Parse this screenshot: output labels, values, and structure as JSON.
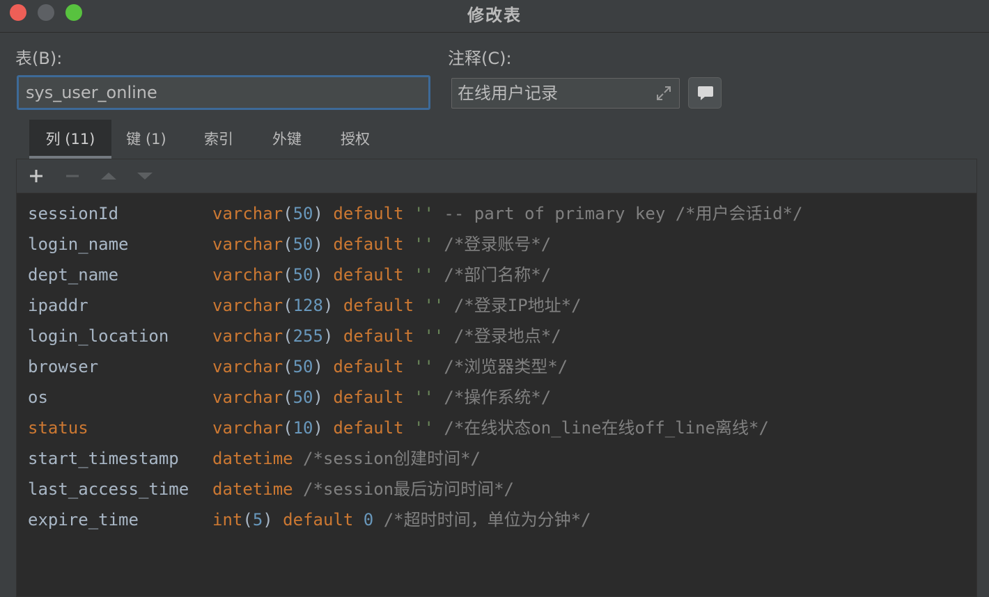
{
  "window": {
    "title": "修改表",
    "buttons": [
      "close",
      "minimize",
      "maximize"
    ]
  },
  "form": {
    "table_label": "表(B):",
    "table_value": "sys_user_online",
    "comment_label": "注释(C):",
    "comment_value": "在线用户记录"
  },
  "tabs": [
    {
      "label": "列 (11)",
      "active": true
    },
    {
      "label": "键 (1)",
      "active": false
    },
    {
      "label": "索引",
      "active": false
    },
    {
      "label": "外键",
      "active": false
    },
    {
      "label": "授权",
      "active": false
    }
  ],
  "toolbar": {
    "icons": [
      "plus-icon",
      "minus-icon",
      "move-up-icon",
      "move-down-icon"
    ]
  },
  "columns": [
    {
      "name": "sessionId",
      "type": "varchar",
      "size": "50",
      "default_kw": "default",
      "default_val": "''",
      "comment": "-- part of primary key /*用户会话id*/"
    },
    {
      "name": "login_name",
      "type": "varchar",
      "size": "50",
      "default_kw": "default",
      "default_val": "''",
      "comment": "/*登录账号*/"
    },
    {
      "name": "dept_name",
      "type": "varchar",
      "size": "50",
      "default_kw": "default",
      "default_val": "''",
      "comment": "/*部门名称*/"
    },
    {
      "name": "ipaddr",
      "type": "varchar",
      "size": "128",
      "default_kw": "default",
      "default_val": "''",
      "comment": "/*登录IP地址*/"
    },
    {
      "name": "login_location",
      "type": "varchar",
      "size": "255",
      "default_kw": "default",
      "default_val": "''",
      "comment": "/*登录地点*/"
    },
    {
      "name": "browser",
      "type": "varchar",
      "size": "50",
      "default_kw": "default",
      "default_val": "''",
      "comment": "/*浏览器类型*/"
    },
    {
      "name": "os",
      "type": "varchar",
      "size": "50",
      "default_kw": "default",
      "default_val": "''",
      "comment": "/*操作系统*/"
    },
    {
      "name": "status",
      "type": "varchar",
      "size": "10",
      "default_kw": "default",
      "default_val": "''",
      "comment": "/*在线状态on_line在线off_line离线*/"
    },
    {
      "name": "start_timestamp",
      "type": "datetime",
      "size": "",
      "default_kw": "",
      "default_val": "",
      "comment": "/*session创建时间*/"
    },
    {
      "name": "last_access_time",
      "type": "datetime",
      "size": "",
      "default_kw": "",
      "default_val": "",
      "comment": "/*session最后访问时间*/"
    },
    {
      "name": "expire_time",
      "type": "int",
      "size": "5",
      "default_kw": "default",
      "default_val": "0",
      "comment": "/*超时时间，单位为分钟*/"
    }
  ],
  "colors": {
    "keyword": "#cc7832",
    "number": "#6897bb",
    "string": "#6a8759",
    "comment": "#808080",
    "identifier": "#a9b7c6",
    "focus_border": "#3d6a98"
  }
}
